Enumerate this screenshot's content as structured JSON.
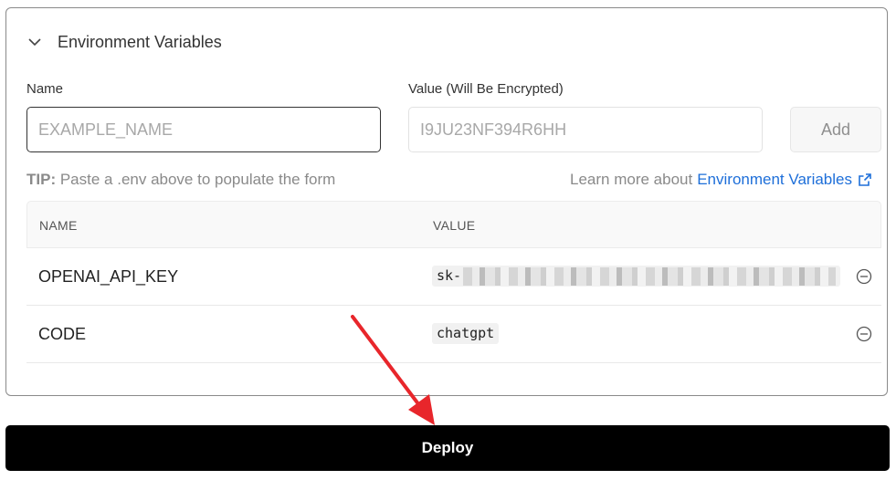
{
  "section": {
    "title": "Environment Variables",
    "expanded": true
  },
  "form": {
    "name_label": "Name",
    "value_label": "Value (Will Be Encrypted)",
    "name_placeholder": "EXAMPLE_NAME",
    "value_placeholder": "I9JU23NF394R6HH",
    "add_label": "Add"
  },
  "tip": {
    "prefix": "TIP:",
    "text": "Paste a .env above to populate the form",
    "learn_more_text": "Learn more about",
    "link_text": "Environment Variables"
  },
  "table": {
    "headers": [
      "NAME",
      "VALUE"
    ],
    "rows": [
      {
        "name": "OPENAI_API_KEY",
        "value": "sk-",
        "redacted": true
      },
      {
        "name": "CODE",
        "value": "chatgpt",
        "redacted": false
      }
    ]
  },
  "deploy": {
    "label": "Deploy"
  },
  "colors": {
    "accent_link": "#1e6fd9",
    "deploy_bg": "#000000",
    "annotation_arrow": "#e8262b"
  },
  "icons": {
    "collapse": "chevron-down-icon",
    "external": "external-link-icon",
    "remove": "minus-circle-icon"
  }
}
